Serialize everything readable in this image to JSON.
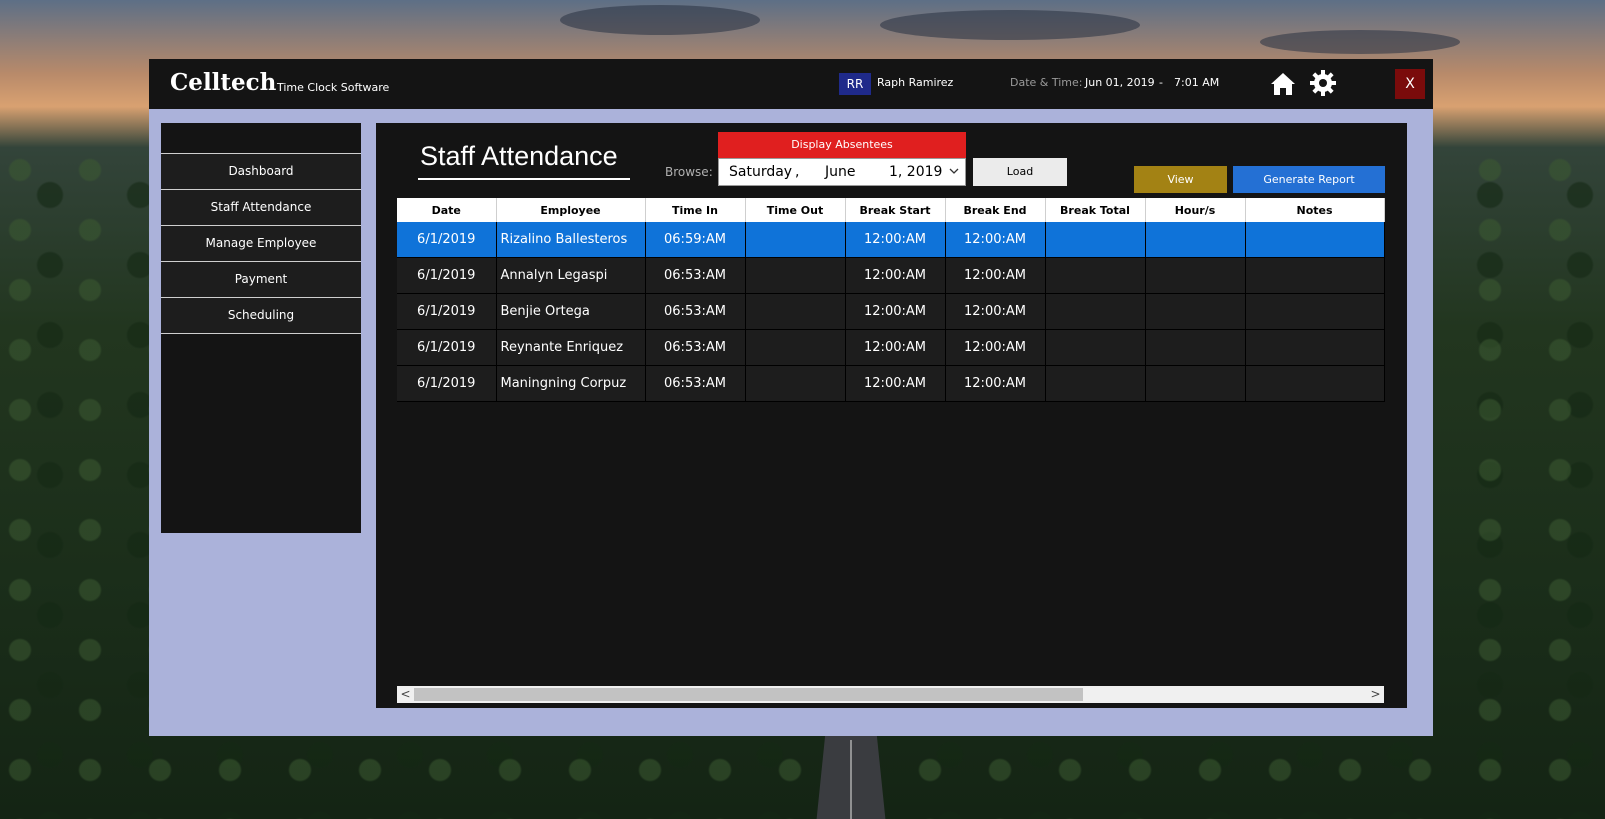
{
  "titlebar": {
    "brand": "Celltech",
    "brand_sub": "Time Clock Software",
    "avatar_initials": "RR",
    "user_name": "Raph Ramirez",
    "datetime_label": "Date & Time:",
    "date": "Jun 01, 2019",
    "separator": "-",
    "time": "7:01 AM",
    "close_label": "X",
    "icons": [
      "home-icon",
      "gear-icon"
    ]
  },
  "sidebar": {
    "items": [
      {
        "label": "Dashboard"
      },
      {
        "label": "Staff Attendance"
      },
      {
        "label": "Manage Employee"
      },
      {
        "label": "Payment"
      },
      {
        "label": "Scheduling"
      }
    ]
  },
  "main": {
    "title": "Staff Attendance",
    "browse_label": "Browse:",
    "absentees_label": "Display Absentees",
    "date_picker": {
      "day": "Saturday",
      "comma": ",",
      "month": "June",
      "date_year": "1, 2019"
    },
    "load_label": "Load",
    "view_label": "View",
    "report_label": "Generate Report"
  },
  "table": {
    "columns": [
      "Date",
      "Employee",
      "Time In",
      "Time Out",
      "Break Start",
      "Break End",
      "Break Total",
      "Hour/s",
      "Notes"
    ],
    "rows": [
      [
        "6/1/2019",
        "Rizalino Ballesteros",
        "06:59:AM",
        "",
        "12:00:AM",
        "12:00:AM",
        "",
        "",
        ""
      ],
      [
        "6/1/2019",
        "Annalyn Legaspi",
        "06:53:AM",
        "",
        "12:00:AM",
        "12:00:AM",
        "",
        "",
        ""
      ],
      [
        "6/1/2019",
        "Benjie Ortega",
        "06:53:AM",
        "",
        "12:00:AM",
        "12:00:AM",
        "",
        "",
        ""
      ],
      [
        "6/1/2019",
        "Reynante Enriquez",
        "06:53:AM",
        "",
        "12:00:AM",
        "12:00:AM",
        "",
        "",
        ""
      ],
      [
        "6/1/2019",
        "Maningning Corpuz",
        "06:53:AM",
        "",
        "12:00:AM",
        "12:00:AM",
        "",
        "",
        ""
      ]
    ],
    "selected_row": 0
  },
  "scrollbar": {
    "left_arrow": "<",
    "right_arrow": ">"
  },
  "colors": {
    "accent_red": "#e01f1f",
    "accent_blue": "#2470d4",
    "accent_gold": "#a38214",
    "selection": "#0f73d9",
    "window_bg": "#abb2da",
    "close_red": "#7a0b0b"
  }
}
